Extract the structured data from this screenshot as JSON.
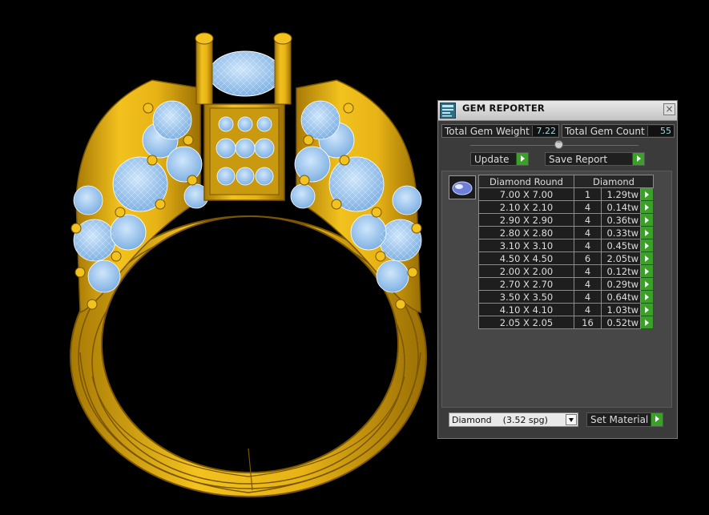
{
  "panel": {
    "title": "GEM REPORTER",
    "close_label": "×",
    "total_weight_label": "Total Gem Weight",
    "total_weight_value": "7.22",
    "total_count_label": "Total Gem Count",
    "total_count_value": "55",
    "update_label": "Update",
    "save_report_label": "Save Report",
    "set_material_label": "Set Material",
    "material_value": "Diamond    (3.52 spg)"
  },
  "table": {
    "headers": [
      "Diamond Round",
      "Diamond"
    ],
    "rows": [
      {
        "size": "7.00 X 7.00",
        "count": "1",
        "weight": "1.29tw"
      },
      {
        "size": "2.10 X 2.10",
        "count": "4",
        "weight": "0.14tw"
      },
      {
        "size": "2.90 X 2.90",
        "count": "4",
        "weight": "0.36tw"
      },
      {
        "size": "2.80 X 2.80",
        "count": "4",
        "weight": "0.33tw"
      },
      {
        "size": "3.10 X 3.10",
        "count": "4",
        "weight": "0.45tw"
      },
      {
        "size": "4.50 X 4.50",
        "count": "6",
        "weight": "2.05tw"
      },
      {
        "size": "2.00 X 2.00",
        "count": "4",
        "weight": "0.12tw"
      },
      {
        "size": "2.70 X 2.70",
        "count": "4",
        "weight": "0.29tw"
      },
      {
        "size": "3.50 X 3.50",
        "count": "4",
        "weight": "0.64tw"
      },
      {
        "size": "4.10 X 4.10",
        "count": "4",
        "weight": "1.03tw"
      },
      {
        "size": "2.05 X 2.05",
        "count": "16",
        "weight": "0.52tw"
      }
    ]
  },
  "colors": {
    "gold": "#e8b317",
    "gem": "#9ec8f0",
    "panel_bg": "#3b3b3b",
    "go_button": "#3aa02a"
  },
  "icons": [
    "gem-reporter-app-icon",
    "close-icon",
    "play-arrow-icon",
    "chevron-down-icon",
    "gem-thumbnail-icon"
  ]
}
